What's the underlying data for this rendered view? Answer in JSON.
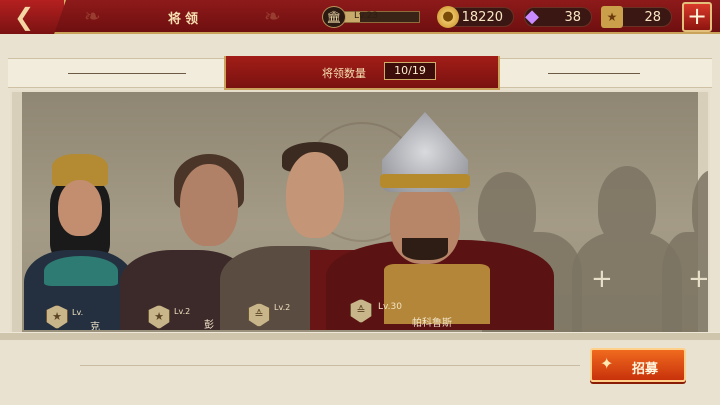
{
  "topbar": {
    "title": "将领",
    "level_label": "Lv.23",
    "level_progress": 0.2,
    "resources": {
      "coins": "18220",
      "gems": "38",
      "tickets": "28"
    }
  },
  "header": {
    "count_label": "将领数量",
    "count_value": "10/19"
  },
  "heroes": [
    {
      "level": "Lv.",
      "name": "克",
      "badge_icon": "rank-star-icon"
    },
    {
      "level": "Lv.2",
      "name": "彭",
      "badge_icon": "rank-star-icon"
    },
    {
      "level": "Lv.2",
      "name": "",
      "badge_icon": "rank-chevron-icon"
    },
    {
      "level": "Lv.30",
      "name": "帕科鲁斯",
      "badge_icon": "rank-chevron-icon"
    }
  ],
  "recruit": {
    "label": "招募"
  },
  "colors": {
    "topbar_red": "#7a1212",
    "gold_trim": "#c9a35a",
    "recruit_orange": "#e0501a"
  }
}
